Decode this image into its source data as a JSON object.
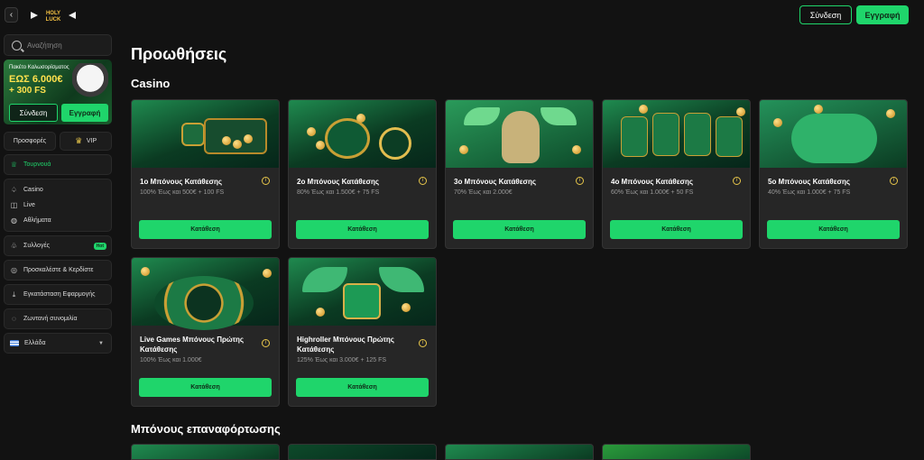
{
  "topbar": {
    "back_icon": "chevron-left-icon",
    "logo_text": "HOLY LUCK",
    "login_label": "Σύνδεση",
    "register_label": "Εγγραφή"
  },
  "sidebar": {
    "search_placeholder": "Αναζήτηση",
    "promo": {
      "title": "Πακέτο Καλωσορίσματος",
      "amount": "ΕΩΣ 6.000€",
      "fs": "+ 300 FS",
      "login_label": "Σύνδεση",
      "register_label": "Εγγραφή"
    },
    "promos_label": "Προσφορές",
    "vip_label": "VIP",
    "tournaments_label": "Τουρνουά",
    "casino_label": "Casino",
    "live_label": "Live",
    "sports_label": "Αθλήματα",
    "collections_label": "Συλλογές",
    "hot_badge": "Hot",
    "invite_label": "Προσκαλέστε & Κερδίστε",
    "install_label": "Εγκατάσταση Εφαρμογής",
    "chat_label": "Ζωντανή συνομιλία",
    "language_label": "Ελλάδα"
  },
  "main": {
    "page_title": "Προωθήσεις",
    "casino_section": "Casino",
    "reload_section": "Μπόνους επαναφόρτωσης",
    "deposit_label": "Κατάθεση",
    "cards": [
      {
        "title": "1ο Μπόνους Κατάθεσης",
        "subtitle": "100% Έως και 500€ + 100 FS"
      },
      {
        "title": "2ο Μπόνους Κατάθεσης",
        "subtitle": "80% Έως και 1.500€ + 75 FS"
      },
      {
        "title": "3ο Μπόνους Κατάθεσης",
        "subtitle": "70% Έως και 2.000€"
      },
      {
        "title": "4ο Μπόνους Κατάθεσης",
        "subtitle": "60% Έως και 1.000€ + 50 FS"
      },
      {
        "title": "5ο Μπόνους Κατάθεσης",
        "subtitle": "40% Έως και 1.000€ + 75 FS"
      },
      {
        "title": "Live Games Μπόνους Πρώτης Κατάθεσης",
        "subtitle": "100% Έως και 1.000€"
      },
      {
        "title": "Highroller Μπόνους Πρώτης Κατάθεσης",
        "subtitle": "125% Έως και 3.000€ + 125 FS"
      }
    ]
  },
  "colors": {
    "accent": "#1fd56b",
    "background": "#121212",
    "card": "#262626",
    "gold": "#e7c64a"
  }
}
